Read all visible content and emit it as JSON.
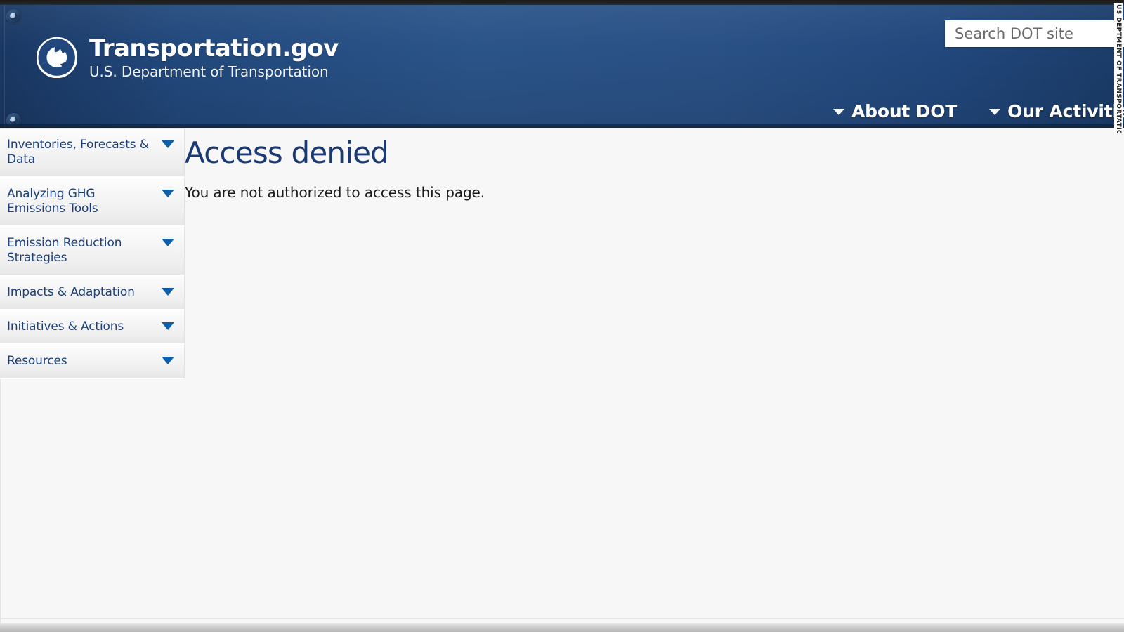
{
  "header": {
    "brand_title": "Transportation.gov",
    "brand_subtitle": "U.S. Department of Transportation",
    "seal_icon": "dot-triskelion-seal-icon",
    "grommet_icon": "grommet-icon",
    "search": {
      "value": "",
      "placeholder": "Search DOT site",
      "icon": "search-icon"
    },
    "nav": [
      {
        "label": "About DOT",
        "caret_icon": "chevron-down-icon"
      },
      {
        "label": "Our Activities",
        "caret_icon": "chevron-down-icon"
      }
    ],
    "colors": {
      "header_blue": "#2a5186",
      "header_blue_dark": "#1a3864",
      "nav_text": "#ffffff"
    }
  },
  "edge_watermark": {
    "text": "US DEPTMENT OF TRANSPORTATION"
  },
  "sidebar": {
    "items": [
      {
        "label": "Inventories, Forecasts & Data",
        "caret_icon": "chevron-down-icon"
      },
      {
        "label": "Analyzing GHG Emissions Tools",
        "caret_icon": "chevron-down-icon"
      },
      {
        "label": "Emission Reduction Strategies",
        "caret_icon": "chevron-down-icon"
      },
      {
        "label": "Impacts & Adaptation",
        "caret_icon": "chevron-down-icon"
      },
      {
        "label": "Initiatives & Actions",
        "caret_icon": "chevron-down-icon"
      },
      {
        "label": "Resources",
        "caret_icon": "chevron-down-icon"
      }
    ],
    "colors": {
      "label": "#1b3f7a",
      "caret": "#0e5fa8"
    }
  },
  "main": {
    "title": "Access denied",
    "message": "You are not authorized to access this page.",
    "colors": {
      "title": "#1a3a74",
      "body_text": "#1b1b1b",
      "background": "#f7f7f7"
    }
  }
}
